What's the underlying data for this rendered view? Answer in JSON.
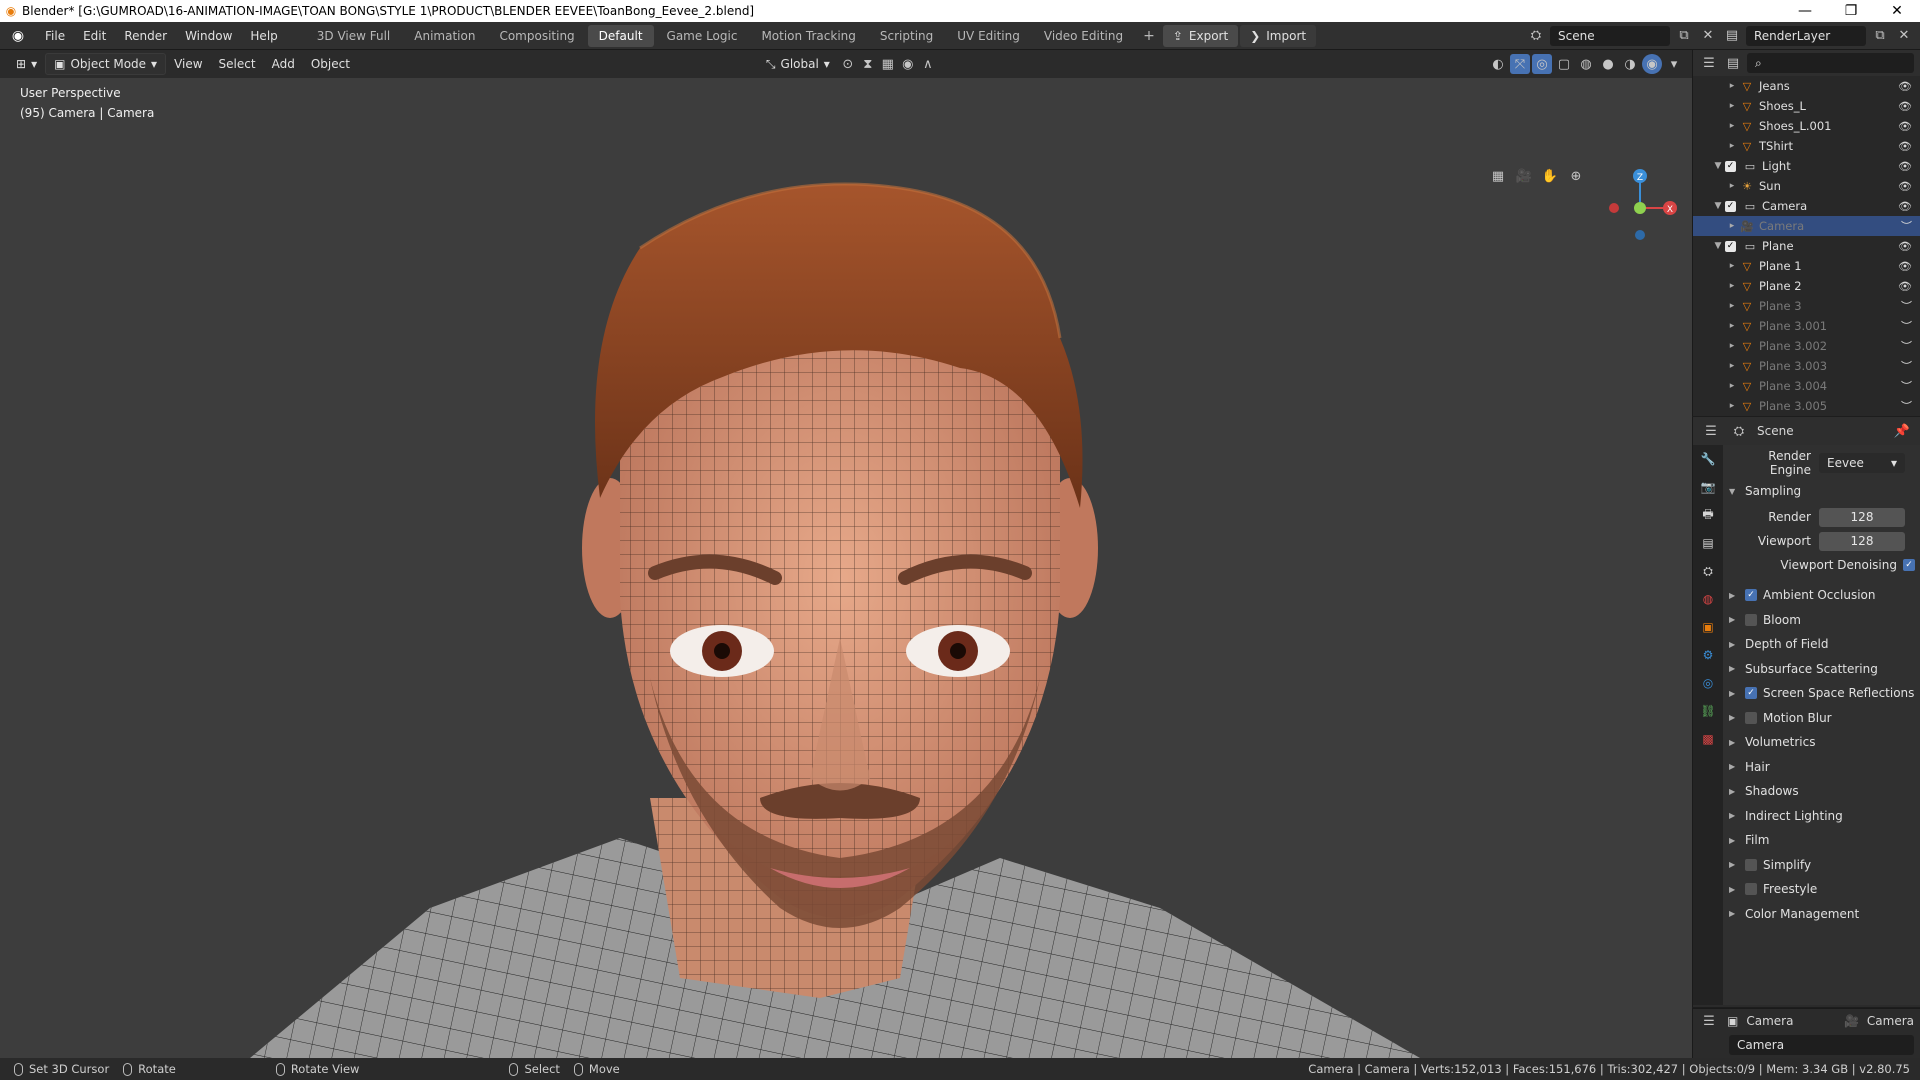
{
  "window": {
    "title": "Blender* [G:\\GUMROAD\\16-ANIMATION-IMAGE\\TOAN BONG\\STYLE 1\\PRODUCT\\BLENDER EEVEE\\ToanBong_Eevee_2.blend]"
  },
  "menubar": {
    "items": [
      "File",
      "Edit",
      "Render",
      "Window",
      "Help"
    ]
  },
  "workspaces": [
    "3D View Full",
    "Animation",
    "Compositing",
    "Default",
    "Game Logic",
    "Motion Tracking",
    "Scripting",
    "UV Editing",
    "Video Editing"
  ],
  "active_workspace": "Default",
  "top_buttons": {
    "export": "Export",
    "import": "Import"
  },
  "scene": {
    "name": "Scene",
    "view_layer": "RenderLayer"
  },
  "viewport_header": {
    "mode": "Object Mode",
    "menus": [
      "View",
      "Select",
      "Add",
      "Object"
    ],
    "orientation": "Global"
  },
  "viewport": {
    "perspective": "User Perspective",
    "object_info": "(95) Camera | Camera",
    "gizmo_labels": {
      "z": "Z",
      "x": "X"
    }
  },
  "outliner": {
    "rows": [
      {
        "name": "Jeans",
        "type": "mesh",
        "level": 2,
        "visible": true
      },
      {
        "name": "Shoes_L",
        "type": "mesh",
        "level": 2,
        "visible": true
      },
      {
        "name": "Shoes_L.001",
        "type": "mesh",
        "level": 2,
        "visible": true
      },
      {
        "name": "TShirt",
        "type": "mesh",
        "level": 2,
        "visible": true
      },
      {
        "name": "Light",
        "type": "collection",
        "level": 1,
        "visible": true
      },
      {
        "name": "Sun",
        "type": "light",
        "level": 2,
        "visible": true
      },
      {
        "name": "Camera",
        "type": "collection",
        "level": 1,
        "visible": true
      },
      {
        "name": "Camera",
        "type": "camera",
        "level": 2,
        "visible": false,
        "selected": true
      },
      {
        "name": "Plane",
        "type": "collection",
        "level": 1,
        "visible": true
      },
      {
        "name": "Plane 1",
        "type": "mesh",
        "level": 2,
        "visible": true
      },
      {
        "name": "Plane 2",
        "type": "mesh",
        "level": 2,
        "visible": true
      },
      {
        "name": "Plane 3",
        "type": "mesh",
        "level": 2,
        "visible": false
      },
      {
        "name": "Plane 3.001",
        "type": "mesh",
        "level": 2,
        "visible": false
      },
      {
        "name": "Plane 3.002",
        "type": "mesh",
        "level": 2,
        "visible": false
      },
      {
        "name": "Plane 3.003",
        "type": "mesh",
        "level": 2,
        "visible": false
      },
      {
        "name": "Plane 3.004",
        "type": "mesh",
        "level": 2,
        "visible": false
      },
      {
        "name": "Plane 3.005",
        "type": "mesh",
        "level": 2,
        "visible": false
      }
    ]
  },
  "properties": {
    "header": "Scene",
    "render_engine_label": "Render Engine",
    "render_engine": "Eevee",
    "sampling": {
      "title": "Sampling",
      "render_label": "Render",
      "render": "128",
      "viewport_label": "Viewport",
      "viewport": "128",
      "denoise_label": "Viewport Denoising",
      "denoise": true
    },
    "panels": [
      {
        "label": "Ambient Occlusion",
        "checkbox": true,
        "checked": true
      },
      {
        "label": "Bloom",
        "checkbox": true,
        "checked": false
      },
      {
        "label": "Depth of Field",
        "checkbox": false
      },
      {
        "label": "Subsurface Scattering",
        "checkbox": false
      },
      {
        "label": "Screen Space Reflections",
        "checkbox": true,
        "checked": true
      },
      {
        "label": "Motion Blur",
        "checkbox": true,
        "checked": false
      },
      {
        "label": "Volumetrics",
        "checkbox": false
      },
      {
        "label": "Hair",
        "checkbox": false
      },
      {
        "label": "Shadows",
        "checkbox": false
      },
      {
        "label": "Indirect Lighting",
        "checkbox": false
      },
      {
        "label": "Film",
        "checkbox": false
      },
      {
        "label": "Simplify",
        "checkbox": true,
        "checked": false
      },
      {
        "label": "Freestyle",
        "checkbox": true,
        "checked": false
      },
      {
        "label": "Color Management",
        "checkbox": false
      }
    ]
  },
  "bottom_panel": {
    "left": "Camera",
    "right": "Camera",
    "field": "Camera"
  },
  "statusbar": {
    "items": [
      "Set 3D Cursor",
      "Rotate",
      "Rotate View",
      "Select",
      "Move"
    ],
    "info": "Camera | Camera | Verts:152,013 | Faces:151,676 | Tris:302,427 | Objects:0/9 | Mem: 3.34 GB | v2.80.75"
  },
  "colors": {
    "accent": "#4772b3",
    "selection": "#334d80",
    "orange": "#e87d0d"
  }
}
